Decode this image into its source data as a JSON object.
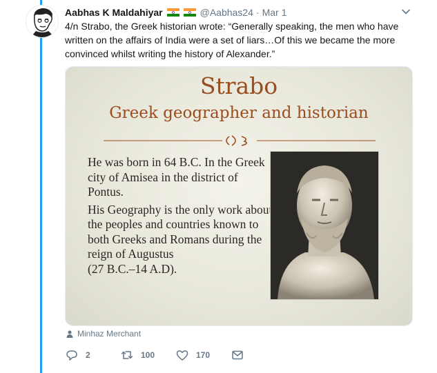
{
  "tweet": {
    "author_name": "Aabhas K Maldahiyar",
    "flags": [
      "india-flag-icon",
      "india-flag-icon"
    ],
    "handle": "@Aabhas24",
    "separator": "·",
    "date": "Mar 1",
    "text": "4/n Strabo, the Greek historian wrote: “Generally speaking, the men who have written on the affairs of India were a set of liars…Of this we became the more convinced whilst writing the history of Alexander.”"
  },
  "media": {
    "title": "Strabo",
    "subtitle": "Greek geographer and historian",
    "paragraph1": "He was born in 64 B.C. In the Greek city of Amisea in the district of Pontus.",
    "paragraph2": "His Geography is the only work about the peoples and countries known to both Greeks and Romans during the reign of Augustus",
    "paragraph3": "(27 B.C.–14 A.D).",
    "title_color": "#9a4d1f"
  },
  "attribution": "Minhaz Merchant",
  "actions": {
    "reply_count": "2",
    "retweet_count": "100",
    "like_count": "170"
  },
  "colors": {
    "accent": "#1da1f2",
    "muted": "#657786"
  }
}
